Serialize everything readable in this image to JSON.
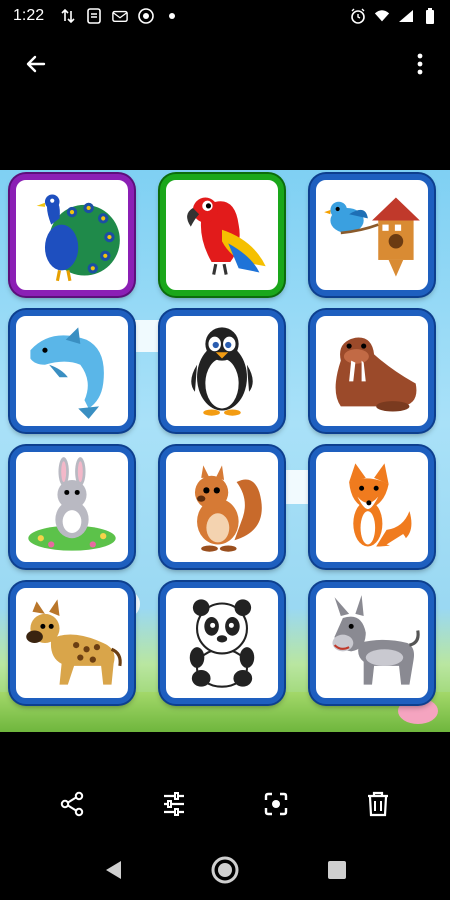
{
  "status_bar": {
    "time": "1:22",
    "left_icons": [
      "data-transfer-icon",
      "document-icon",
      "mail-icon",
      "chrome-icon",
      "dot-icon"
    ],
    "right_icons": [
      "alarm-icon",
      "wifi-icon",
      "signal-icon",
      "battery-icon"
    ]
  },
  "toolbar": {
    "back_icon": "arrow-back-icon",
    "more_icon": "more-vert-icon"
  },
  "photo": {
    "tiles": [
      {
        "animal": "peacock",
        "frame": "purple"
      },
      {
        "animal": "parrot",
        "frame": "green"
      },
      {
        "animal": "birdhouse",
        "frame": "blue"
      },
      {
        "animal": "dolphin",
        "frame": "blue"
      },
      {
        "animal": "penguin",
        "frame": "blue"
      },
      {
        "animal": "walrus",
        "frame": "blue"
      },
      {
        "animal": "rabbit",
        "frame": "blue"
      },
      {
        "animal": "squirrel",
        "frame": "blue"
      },
      {
        "animal": "fox",
        "frame": "blue"
      },
      {
        "animal": "hyena",
        "frame": "blue"
      },
      {
        "animal": "panda",
        "frame": "blue"
      },
      {
        "animal": "donkey",
        "frame": "blue"
      }
    ]
  },
  "bottom_actions": [
    "share-icon",
    "edit-adjust-icon",
    "lens-icon",
    "delete-icon"
  ],
  "nav_bar": [
    "back-nav-icon",
    "home-nav-icon",
    "recents-nav-icon"
  ],
  "colors": {
    "frame_blue": "#1e5fbf",
    "frame_purple": "#8b1fb5",
    "frame_green": "#1aa71a",
    "sky": "#9ad8f2"
  }
}
